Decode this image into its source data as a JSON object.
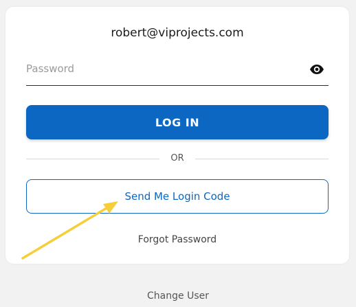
{
  "account": {
    "email": "robert@viprojects.com"
  },
  "password": {
    "placeholder": "Password",
    "value": ""
  },
  "icons": {
    "show_password": "eye-icon"
  },
  "buttons": {
    "login": "LOG IN",
    "send_code": "Send Me Login Code"
  },
  "divider": {
    "text": "OR"
  },
  "links": {
    "forgot_password": "Forgot Password",
    "change_user": "Change User"
  },
  "colors": {
    "primary": "#0b67c2",
    "background": "#f2f2f2",
    "card": "#ffffff",
    "annotation_arrow": "#f5cf3a"
  }
}
